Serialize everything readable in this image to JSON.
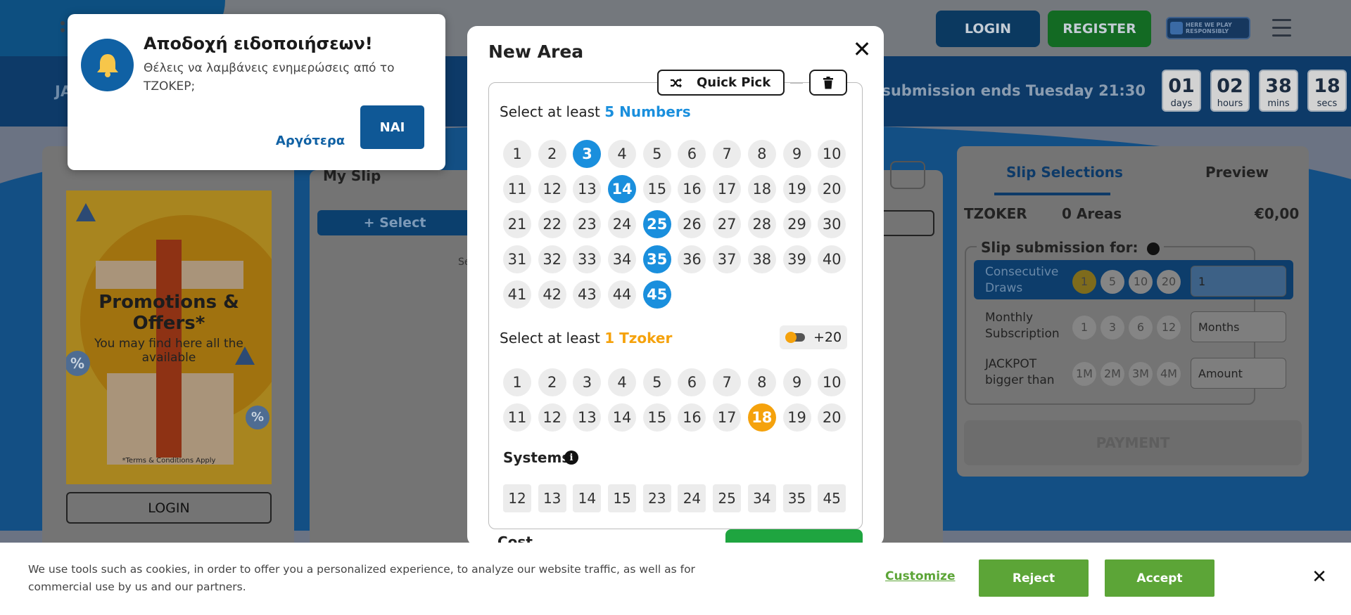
{
  "header": {
    "login_label": "LOGIN",
    "register_label": "REGISTER",
    "responsible_text": "HERE WE PLAY RESPONSIBLY",
    "draw_prefix": "JA",
    "submission_ends": "t submission ends Tuesday 21:30"
  },
  "countdown": [
    {
      "value": "01",
      "unit": "days"
    },
    {
      "value": "02",
      "unit": "hours"
    },
    {
      "value": "38",
      "unit": "mins"
    },
    {
      "value": "18",
      "unit": "secs"
    }
  ],
  "promo": {
    "title": "Promotions & Offers*",
    "subtitle": "You may find here all the available",
    "terms": "*Terms & Conditions Apply",
    "badge": "%",
    "login_label": "LOGIN"
  },
  "my_slip": {
    "title": "My Slip",
    "select_label": "+ Select",
    "hint_fragment": "Se"
  },
  "slip_panel": {
    "tab_selections": "Slip Selections",
    "tab_preview": "Preview",
    "game": "TZOKER",
    "areas": "0 Areas",
    "amount": "€0,00",
    "submission_title": "Slip submission for:",
    "rows": [
      {
        "label": "Consecutive Draws",
        "options": [
          "1",
          "5",
          "10",
          "20"
        ],
        "select": "1"
      },
      {
        "label": "Monthly Subscription",
        "options": [
          "1",
          "3",
          "6",
          "12"
        ],
        "select": "Months"
      },
      {
        "label": "JACKPOT bigger than",
        "options": [
          "1M",
          "2M",
          "3M",
          "4M"
        ],
        "select": "Amount"
      }
    ],
    "payment_label": "PAYMENT"
  },
  "notification": {
    "title": "Αποδοχή ειδοποιήσεων!",
    "message": "Θέλεις να λαμβάνεις ενημερώσεις από το ΤΖΟΚΕΡ;",
    "later_label": "Αργότερα",
    "yes_label": "ΝΑΙ"
  },
  "modal": {
    "title": "New Area",
    "quick_pick_label": "Quick Pick",
    "main_prefix": "Select at least",
    "main_highlight": "5 Numbers",
    "main_numbers_max": 45,
    "main_selected": [
      3,
      14,
      25,
      35,
      45
    ],
    "tzoker_prefix": "Select at least",
    "tzoker_highlight": "1 Tzoker",
    "tzoker_toggle_label": "+20",
    "tzoker_numbers_max": 20,
    "tzoker_selected": [
      18
    ],
    "systems_label": "Systems",
    "systems": [
      "12",
      "13",
      "14",
      "15",
      "23",
      "24",
      "25",
      "34",
      "35",
      "45"
    ],
    "cost_label": "Cost",
    "colors": {
      "main_selected": "#1a8fdd",
      "tzoker_selected": "#f5a20c",
      "add_button": "#1fa540"
    }
  },
  "cookie": {
    "text": "We use tools such as cookies, in order to offer you a personalized experience, to analyze our website traffic, as well as for commercial use by us and our partners.",
    "customize_label": "Customize",
    "reject_label": "Reject",
    "accept_label": "Accept",
    "brand_color": "#5ca537"
  }
}
